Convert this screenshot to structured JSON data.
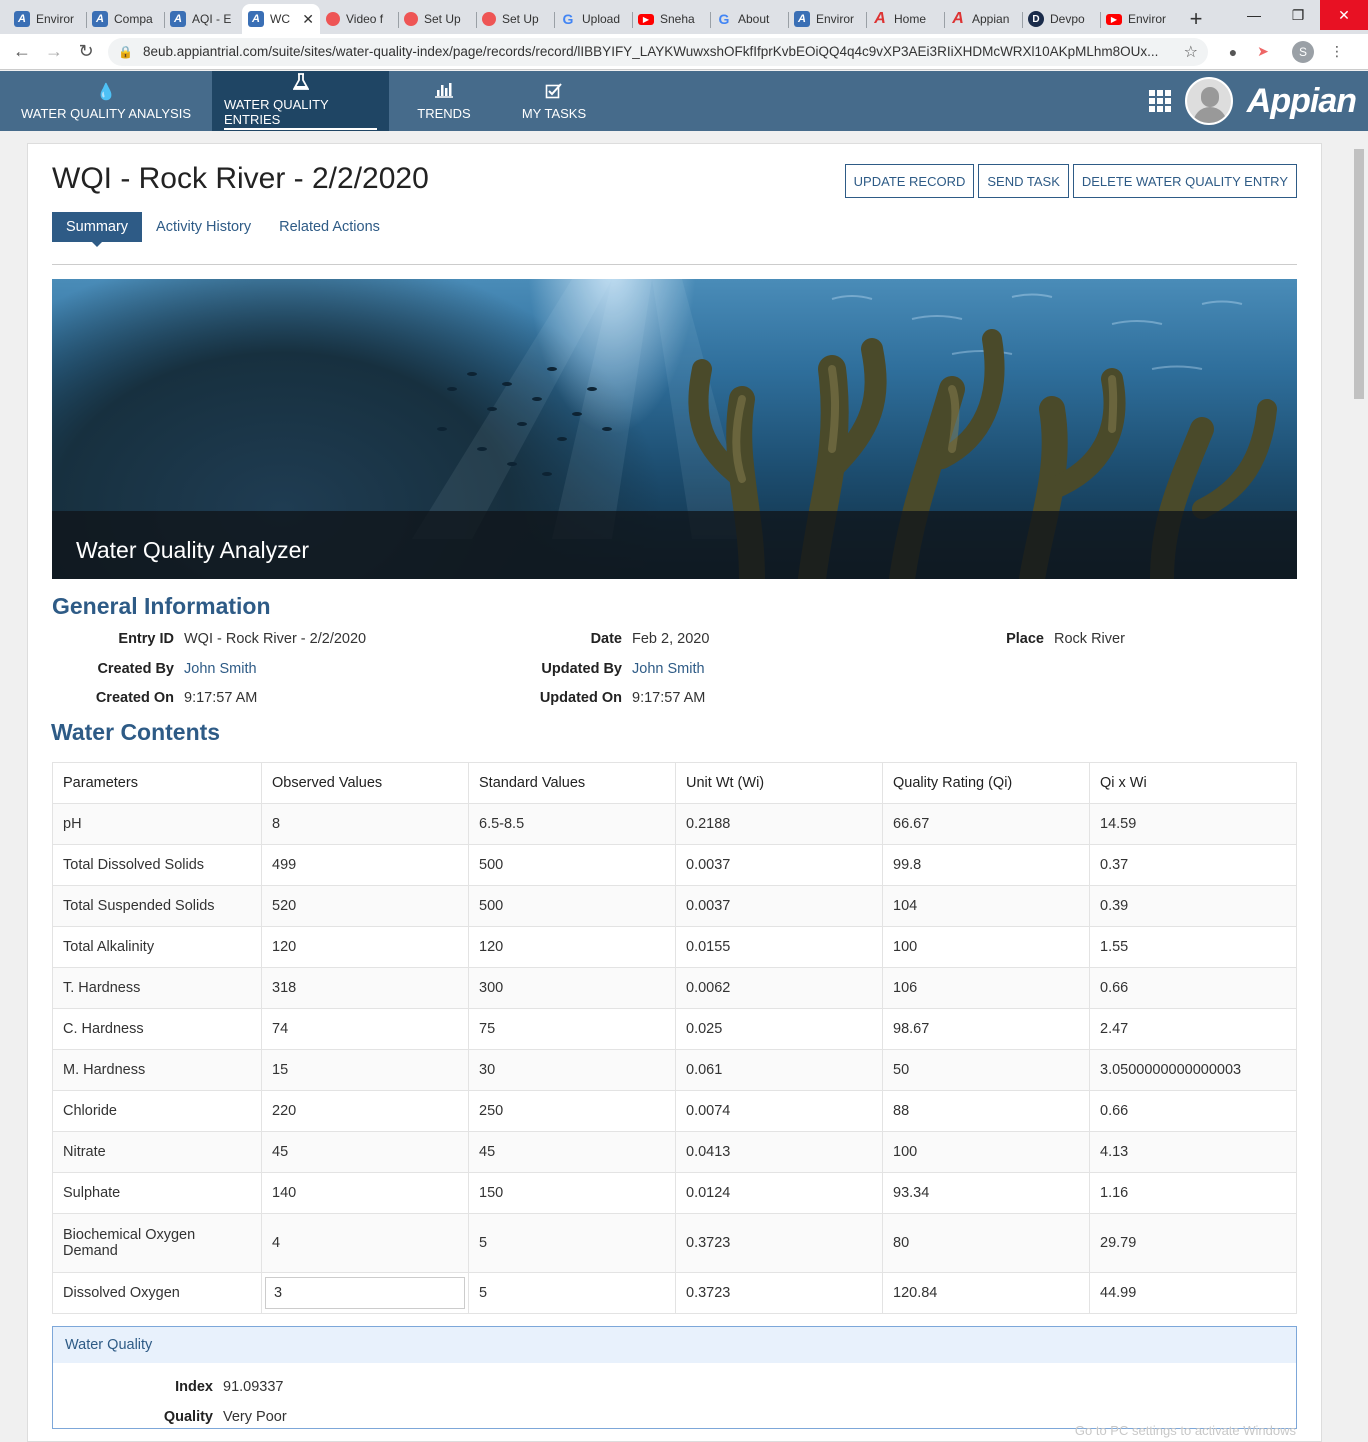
{
  "browser": {
    "tabs": [
      {
        "title": "Enviror",
        "icon": "appian-favicon-icon"
      },
      {
        "title": "Compa",
        "icon": "appian-favicon-icon"
      },
      {
        "title": "AQI - E",
        "icon": "appian-favicon-icon"
      },
      {
        "title": "WC",
        "icon": "appian-favicon-icon",
        "active": true
      },
      {
        "title": "Video f",
        "icon": "video-favicon-icon"
      },
      {
        "title": "Set Up",
        "icon": "video-favicon-icon"
      },
      {
        "title": "Set Up",
        "icon": "video-favicon-icon"
      },
      {
        "title": "Upload",
        "icon": "google-favicon-icon"
      },
      {
        "title": "Sneha",
        "icon": "youtube-favicon-icon"
      },
      {
        "title": "About",
        "icon": "google-favicon-icon"
      },
      {
        "title": "Enviror",
        "icon": "appian-favicon-icon"
      },
      {
        "title": "Home",
        "icon": "appian-red-favicon-icon"
      },
      {
        "title": "Appian",
        "icon": "appian-red-favicon-icon"
      },
      {
        "title": "Devpo",
        "icon": "devpost-favicon-icon"
      },
      {
        "title": "Enviror",
        "icon": "youtube-favicon-icon"
      }
    ],
    "url": "8eub.appiantrial.com/suite/sites/water-quality-index/page/records/record/lIBBYIFY_LAYKWuwxshOFkfIfprKvbEOiQQ4q4c9vXP3AEi3RIiXHDMcWRXl10AKpMLhm8OUx...",
    "profile_initial": "S"
  },
  "app": {
    "nav": [
      {
        "label": "WATER QUALITY ANALYSIS",
        "icon": "water-drop-icon"
      },
      {
        "label": "WATER QUALITY ENTRIES",
        "icon": "flask-icon",
        "active": true
      },
      {
        "label": "TRENDS",
        "icon": "bar-chart-icon"
      },
      {
        "label": "MY TASKS",
        "icon": "checkbox-icon"
      }
    ],
    "logo_text": "Appian"
  },
  "record": {
    "title": "WQI - Rock River - 2/2/2020",
    "actions": [
      "UPDATE RECORD",
      "SEND TASK",
      "DELETE WATER QUALITY ENTRY"
    ],
    "tabs": [
      "Summary",
      "Activity History",
      "Related Actions"
    ],
    "banner_caption": "Water Quality Analyzer"
  },
  "general": {
    "title": "General Information",
    "entry_id_label": "Entry ID",
    "entry_id": "WQI - Rock River - 2/2/2020",
    "date_label": "Date",
    "date": "Feb 2, 2020",
    "place_label": "Place",
    "place": "Rock River",
    "created_by_label": "Created By",
    "created_by": "John Smith",
    "updated_by_label": "Updated By",
    "updated_by": "John Smith",
    "created_on_label": "Created On",
    "created_on": "9:17:57 AM",
    "updated_on_label": "Updated On",
    "updated_on": "9:17:57 AM"
  },
  "contents": {
    "title": "Water Contents",
    "columns": [
      "Parameters",
      "Observed Values",
      "Standard Values",
      "Unit Wt (Wi)",
      "Quality Rating (Qi)",
      "Qi x Wi"
    ],
    "rows": [
      [
        "pH",
        "8",
        "6.5-8.5",
        "0.2188",
        "66.67",
        "14.59"
      ],
      [
        "Total Dissolved Solids",
        "499",
        "500",
        "0.0037",
        "99.8",
        "0.37"
      ],
      [
        "Total Suspended Solids",
        "520",
        "500",
        "0.0037",
        "104",
        "0.39"
      ],
      [
        "Total Alkalinity",
        "120",
        "120",
        "0.0155",
        "100",
        "1.55"
      ],
      [
        "T. Hardness",
        "318",
        "300",
        "0.0062",
        "106",
        "0.66"
      ],
      [
        "C. Hardness",
        "74",
        "75",
        "0.025",
        "98.67",
        "2.47"
      ],
      [
        "M. Hardness",
        "15",
        "30",
        "0.061",
        "50",
        "3.0500000000000003"
      ],
      [
        "Chloride",
        "220",
        "250",
        "0.0074",
        "88",
        "0.66"
      ],
      [
        "Nitrate",
        "45",
        "45",
        "0.0413",
        "100",
        "4.13"
      ],
      [
        "Sulphate",
        "140",
        "150",
        "0.0124",
        "93.34",
        "1.16"
      ],
      [
        "Biochemical Oxygen Demand",
        "4",
        "5",
        "0.3723",
        "80",
        "29.79"
      ],
      [
        "Dissolved Oxygen",
        "3",
        "5",
        "0.3723",
        "120.84",
        "44.99"
      ]
    ]
  },
  "water_quality": {
    "title": "Water Quality",
    "index_label": "Index",
    "index": "91.09337",
    "quality_label": "Quality",
    "quality": "Very Poor"
  },
  "watermark": "Go to PC settings to activate Windows"
}
